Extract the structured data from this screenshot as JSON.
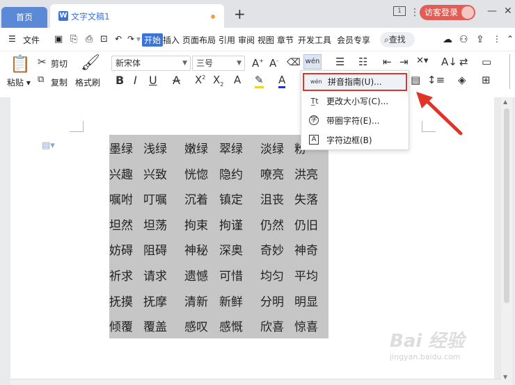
{
  "titlebar": {
    "home_tab": "首页",
    "doc_tab": "文字文稿1",
    "new_tab": "+",
    "login": "访客登录",
    "minimize": "—",
    "close": "✕",
    "page_count": "1"
  },
  "menu": {
    "file": "文件",
    "tabs": [
      "开始",
      "插入",
      "页面布局",
      "引用",
      "审阅",
      "视图",
      "章节",
      "开发工具",
      "会员专享"
    ],
    "search": "查找"
  },
  "ribbon": {
    "paste": "粘贴",
    "cut": "剪切",
    "copy": "复制",
    "format_painter": "格式刷",
    "font_name": "新宋体",
    "font_size": "三号"
  },
  "dropdown": {
    "items": [
      {
        "label": "拼音指南(U)...",
        "icon": "pinyin-guide-icon"
      },
      {
        "label": "更改大小写(C)...",
        "icon": "change-case-icon"
      },
      {
        "label": "带圈字符(E)...",
        "icon": "enclosed-char-icon"
      },
      {
        "label": "字符边框(B)",
        "icon": "char-border-icon"
      }
    ],
    "highlight_color": "#e0332a"
  },
  "document": {
    "rows": [
      [
        "墨绿",
        "浅绿",
        "嫩绿",
        "翠绿",
        "淡绿",
        "粉"
      ],
      [
        "兴趣",
        "兴致",
        "恍惚",
        "隐约",
        "嘹亮",
        "洪亮"
      ],
      [
        "嘱咐",
        "叮嘱",
        "沉着",
        "镇定",
        "沮丧",
        "失落"
      ],
      [
        "坦然",
        "坦荡",
        "拘束",
        "拘谨",
        "仍然",
        "仍旧"
      ],
      [
        "妨碍",
        "阻碍",
        "神秘",
        "深奥",
        "奇妙",
        "神奇"
      ],
      [
        "祈求",
        "请求",
        "遗憾",
        "可惜",
        "均匀",
        "平均"
      ],
      [
        "抚摸",
        "抚摩",
        "清新",
        "新鲜",
        "分明",
        "明显"
      ],
      [
        "倾覆",
        "覆盖",
        "感叹",
        "感慨",
        "欣喜",
        "惊喜"
      ]
    ]
  },
  "colors": {
    "accent": "#3c73d9",
    "login": "#e35d54",
    "selection": "#c6c6c6",
    "arrow": "#e0332a"
  },
  "watermark": {
    "main": "Bai 经验",
    "sub": "jingyan.baidu.com"
  }
}
